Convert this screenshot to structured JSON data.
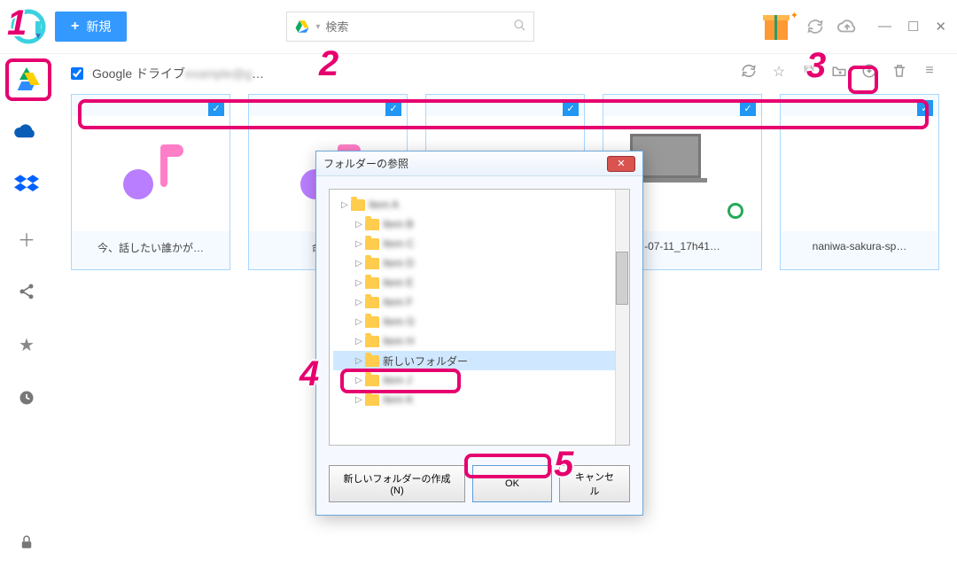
{
  "topbar": {
    "new_label": "新規",
    "search_placeholder": "検索"
  },
  "breadcrumb": {
    "path_prefix": "Google ドライブ",
    "path_obscured": "example@g",
    "path_suffix": "…"
  },
  "cards": [
    {
      "label": "今、話したい誰かが…"
    },
    {
      "label": "命は…"
    },
    {
      "label": "…"
    },
    {
      "label": "-07-11_17h41…"
    },
    {
      "label": "naniwa-sakura-sp…"
    }
  ],
  "dialog": {
    "title": "フォルダーの参照",
    "tree_items": [
      {
        "text": "Item A",
        "blur": true,
        "indent": 0
      },
      {
        "text": "Item B",
        "blur": true,
        "indent": 1
      },
      {
        "text": "Item C",
        "blur": true,
        "indent": 1
      },
      {
        "text": "Item D",
        "blur": true,
        "indent": 1
      },
      {
        "text": "Item E",
        "blur": true,
        "indent": 1
      },
      {
        "text": "Item F",
        "blur": true,
        "indent": 1
      },
      {
        "text": "Item G",
        "blur": true,
        "indent": 1
      },
      {
        "text": "Item H",
        "blur": true,
        "indent": 1
      },
      {
        "text": "新しいフォルダー",
        "blur": false,
        "indent": 1,
        "selected": true
      },
      {
        "text": "Item J",
        "blur": true,
        "indent": 1
      },
      {
        "text": "Item K",
        "blur": true,
        "indent": 1
      }
    ],
    "new_folder_btn": "新しいフォルダーの作成(N)",
    "ok_btn": "OK",
    "cancel_btn": "キャンセル"
  },
  "annotations": {
    "n1": "1",
    "n2": "2",
    "n3": "3",
    "n4": "4",
    "n5": "5"
  }
}
